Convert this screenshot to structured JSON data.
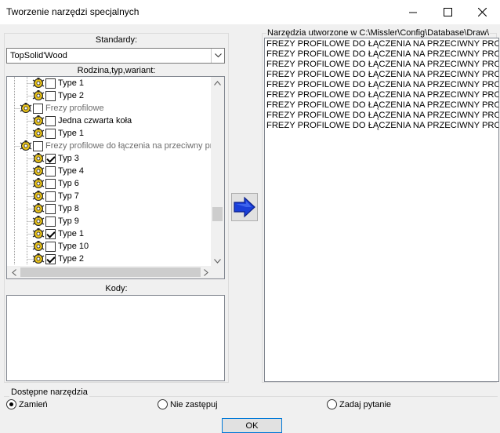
{
  "window": {
    "title": "Tworzenie narzędzi specjalnych",
    "minimize_icon": "minimize-icon",
    "maximize_icon": "maximize-icon",
    "close_icon": "close-icon"
  },
  "left": {
    "standards_label": "Standardy:",
    "standards_value": "TopSolid'Wood",
    "tree_label": "Rodzina,typ,wariant:",
    "codes_label": "Kody:",
    "tree_rows": [
      {
        "text": "Type 1",
        "level": 2,
        "checked": false,
        "gray": false
      },
      {
        "text": "Type 2",
        "level": 2,
        "checked": false,
        "gray": false
      },
      {
        "text": "Frezy profilowe",
        "level": 1,
        "checked": false,
        "gray": true
      },
      {
        "text": "Jedna czwarta koła",
        "level": 2,
        "checked": false,
        "gray": false
      },
      {
        "text": "Type 1",
        "level": 2,
        "checked": false,
        "gray": false
      },
      {
        "text": "Frezy profilowe do łączenia na przeciwny prof",
        "level": 1,
        "checked": false,
        "gray": true
      },
      {
        "text": "Typ 3",
        "level": 2,
        "checked": true,
        "gray": false
      },
      {
        "text": "Type 4",
        "level": 2,
        "checked": false,
        "gray": false
      },
      {
        "text": "Typ 6",
        "level": 2,
        "checked": false,
        "gray": false
      },
      {
        "text": "Typ 7",
        "level": 2,
        "checked": false,
        "gray": false
      },
      {
        "text": "Typ 8",
        "level": 2,
        "checked": false,
        "gray": false
      },
      {
        "text": "Typ 9",
        "level": 2,
        "checked": false,
        "gray": false
      },
      {
        "text": "Type 1",
        "level": 2,
        "checked": true,
        "gray": false
      },
      {
        "text": "Type 10",
        "level": 2,
        "checked": false,
        "gray": false
      },
      {
        "text": "Type 2",
        "level": 2,
        "checked": true,
        "gray": false
      }
    ]
  },
  "right": {
    "label": "Narzędzia utworzone w C:\\Missler\\Config\\Database\\Draw\\",
    "items": [
      "FREZY PROFILOWE DO ŁĄCZENIA NA PRZECIWNY PROFIL",
      "FREZY PROFILOWE DO ŁĄCZENIA NA PRZECIWNY PROFIL",
      "FREZY PROFILOWE DO ŁĄCZENIA NA PRZECIWNY PROFIL",
      "FREZY PROFILOWE DO ŁĄCZENIA NA PRZECIWNY PROFIL",
      "FREZY PROFILOWE DO ŁĄCZENIA NA PRZECIWNY PROFIL",
      "FREZY PROFILOWE DO ŁĄCZENIA NA PRZECIWNY PROFIL",
      "FREZY PROFILOWE DO ŁĄCZENIA NA PRZECIWNY PROFIL",
      "FREZY PROFILOWE DO ŁĄCZENIA NA PRZECIWNY PROFIL",
      "FREZY PROFILOWE DO ŁĄCZENIA NA PRZECIWNY PROFIL"
    ]
  },
  "bottom": {
    "legend": "Dostępne narzędzia",
    "options": [
      {
        "label": "Zamień",
        "selected": true
      },
      {
        "label": "Nie zastępuj",
        "selected": false
      },
      {
        "label": "Zadaj pytanie",
        "selected": false
      }
    ],
    "ok_label": "OK"
  },
  "colors": {
    "arrow_blue": "#1a3fd8",
    "arrow_dark": "#0a1f8a",
    "tool_icon_yellow": "#e8c21a"
  }
}
